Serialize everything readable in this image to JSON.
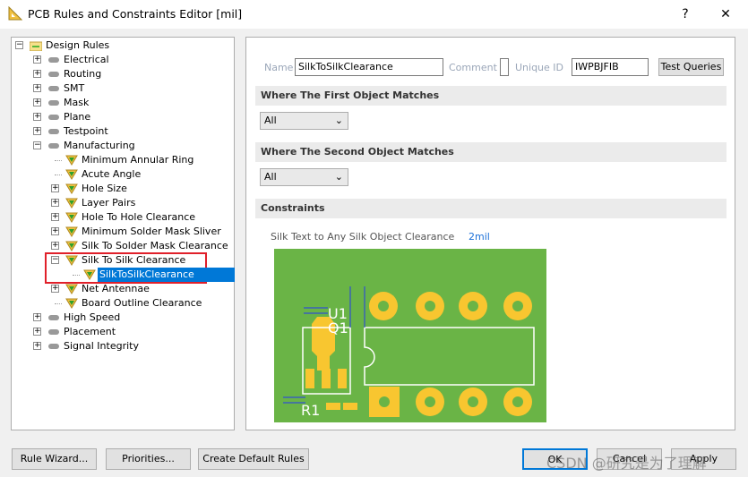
{
  "window": {
    "title": "PCB Rules and Constraints Editor [mil]",
    "help": "?",
    "close": "✕"
  },
  "tree": {
    "root": "Design Rules",
    "items": [
      {
        "label": "Electrical",
        "level": 1,
        "expanded": false
      },
      {
        "label": "Routing",
        "level": 1,
        "expanded": false
      },
      {
        "label": "SMT",
        "level": 1,
        "expanded": false
      },
      {
        "label": "Mask",
        "level": 1,
        "expanded": false
      },
      {
        "label": "Plane",
        "level": 1,
        "expanded": false
      },
      {
        "label": "Testpoint",
        "level": 1,
        "expanded": false
      },
      {
        "label": "Manufacturing",
        "level": 1,
        "expanded": true
      },
      {
        "label": "Minimum Annular Ring",
        "level": 2,
        "leaf": true
      },
      {
        "label": "Acute Angle",
        "level": 2,
        "leaf": true
      },
      {
        "label": "Hole Size",
        "level": 2,
        "expanded": false
      },
      {
        "label": "Layer Pairs",
        "level": 2,
        "expanded": false
      },
      {
        "label": "Hole To Hole Clearance",
        "level": 2,
        "expanded": false
      },
      {
        "label": "Minimum Solder Mask Sliver",
        "level": 2,
        "expanded": false
      },
      {
        "label": "Silk To Solder Mask Clearance",
        "level": 2,
        "expanded": false
      },
      {
        "label": "Silk To Silk Clearance",
        "level": 2,
        "expanded": true
      },
      {
        "label": "SilkToSilkClearance",
        "level": 3,
        "leaf": true,
        "selected": true
      },
      {
        "label": "Net Antennae",
        "level": 2,
        "expanded": false
      },
      {
        "label": "Board Outline Clearance",
        "level": 2,
        "leaf": true
      },
      {
        "label": "High Speed",
        "level": 1,
        "expanded": false
      },
      {
        "label": "Placement",
        "level": 1,
        "expanded": false
      },
      {
        "label": "Signal Integrity",
        "level": 1,
        "expanded": false
      }
    ]
  },
  "rule": {
    "name_label": "Name",
    "name_value": "SilkToSilkClearance",
    "comment_label": "Comment",
    "comment_value": "",
    "uid_label": "Unique ID",
    "uid_value": "IWPBJFIB",
    "test_queries": "Test Queries",
    "first_match": "Where The First Object Matches",
    "first_value": "All",
    "second_match": "Where The Second Object Matches",
    "second_value": "All",
    "constraints": "Constraints",
    "clearance_label": "Silk Text to Any Silk Object Clearance",
    "clearance_value": "2mil",
    "diagram": {
      "labels": [
        "U1",
        "Q1",
        "R1"
      ],
      "board_color": "#6ab446",
      "pad_color": "#f8c630"
    }
  },
  "buttons": {
    "rule_wizard": "Rule Wizard...",
    "priorities": "Priorities...",
    "create_default": "Create Default Rules",
    "ok": "OK",
    "cancel": "Cancel",
    "apply": "Apply"
  },
  "watermark": "CSDN @研究是为了理解"
}
